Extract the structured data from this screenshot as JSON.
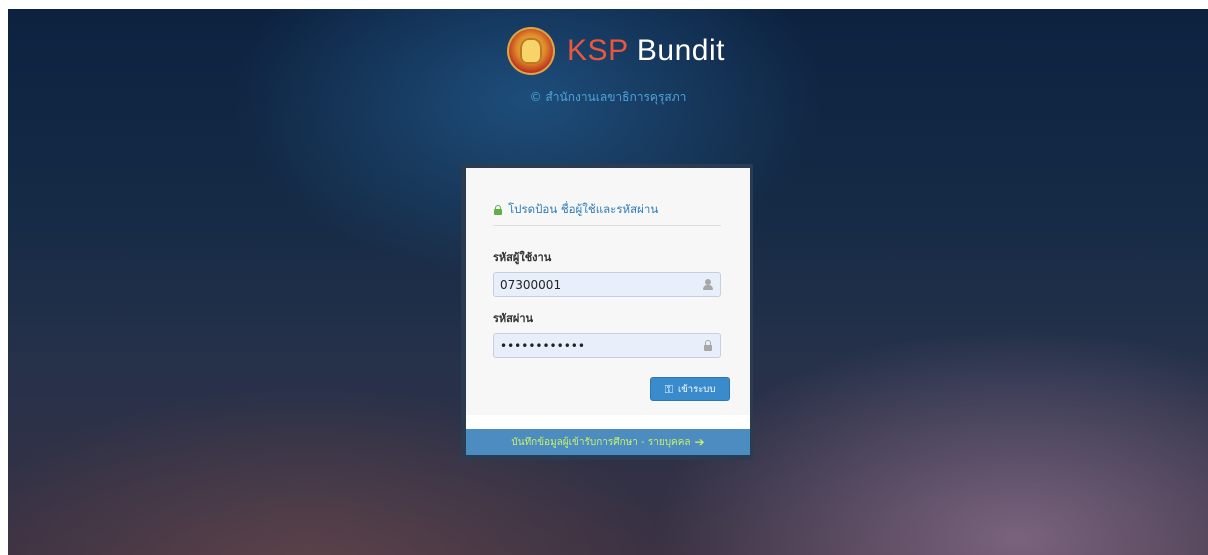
{
  "brand": {
    "name_accent": "KSP",
    "name_rest": " Bundit",
    "subtitle": "© สำนักงานเลขาธิการคุรุสภา"
  },
  "login": {
    "heading": "โปรดป้อน ชื่อผู้ใช้และรหัสผ่าน",
    "username_label": "รหัสผู้ใช้งาน",
    "username_value": "07300001",
    "password_label": "รหัสผ่าน",
    "password_value": "••••••••••••",
    "submit_label": "เข้าระบบ",
    "footer_link": "บันทึกข้อมูลผู้เข้ารับการศึกษา - รายบุคคล"
  },
  "icons": {
    "heading": "lock-icon",
    "username": "user-icon",
    "password": "lock-icon",
    "submit": "key-icon",
    "footer": "arrow-right-icon"
  },
  "colors": {
    "accent": "#e9573f",
    "primary": "#3a8bcc",
    "footer_bar": "#4d8cc0",
    "footer_text": "#c6f06a",
    "heading_text": "#2e7db8",
    "lock_green": "#62b045"
  }
}
